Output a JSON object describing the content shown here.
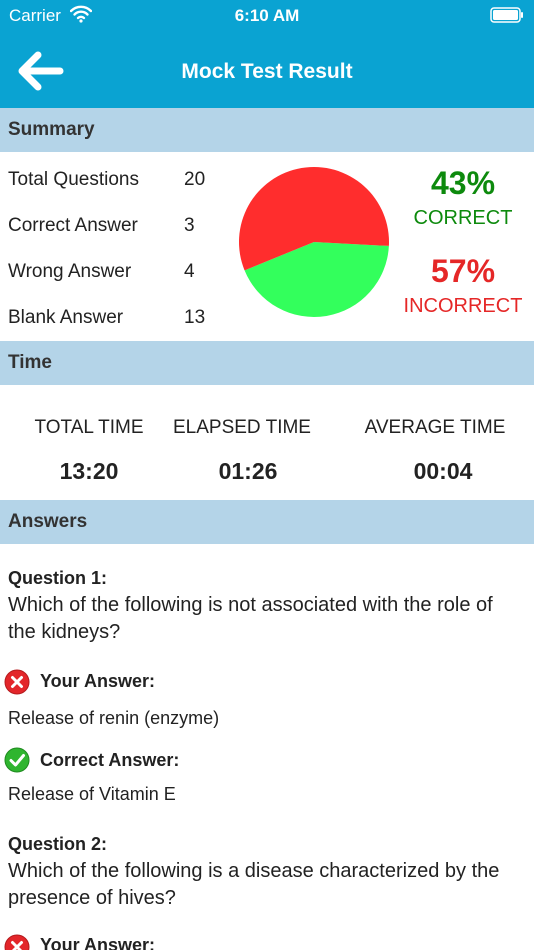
{
  "status_bar": {
    "carrier": "Carrier",
    "time": "6:10 AM"
  },
  "nav": {
    "title": "Mock Test Result",
    "back_icon": "back-arrow-icon"
  },
  "summary": {
    "header": "Summary",
    "rows": [
      {
        "label": "Total Questions",
        "value": "20"
      },
      {
        "label": "Correct Answer",
        "value": "3"
      },
      {
        "label": "Wrong Answer",
        "value": "4"
      },
      {
        "label": "Blank Answer",
        "value": "13"
      }
    ],
    "correct_pct": "43%",
    "correct_label": "CORRECT",
    "incorrect_pct": "57%",
    "incorrect_label": "INCORRECT",
    "colors": {
      "correct": "#33ff5c",
      "incorrect": "#ff2d2d",
      "correct_text": "#0d8a0d",
      "incorrect_text": "#e52727"
    }
  },
  "chart_data": {
    "type": "pie",
    "slices": [
      {
        "label": "CORRECT",
        "value": 43,
        "color": "#33ff5c"
      },
      {
        "label": "INCORRECT",
        "value": 57,
        "color": "#ff2d2d"
      }
    ]
  },
  "time": {
    "header": "Time",
    "items": [
      {
        "label": "TOTAL TIME",
        "value": "13:20"
      },
      {
        "label": "ELAPSED TIME",
        "value": "01:26"
      },
      {
        "label": "AVERAGE TIME",
        "value": "00:04"
      }
    ]
  },
  "answers": {
    "header": "Answers",
    "questions": [
      {
        "title": "Question 1:",
        "text": "Which of the following is not associated with the role of the kidneys?",
        "your_answer_label": "Your Answer:",
        "your_answer": "Release of renin (enzyme)",
        "correct_answer_label": "Correct Answer:",
        "correct_answer": "Release of Vitamin E"
      },
      {
        "title": "Question 2:",
        "text": "Which of the following is a disease characterized by the presence of hives?",
        "your_answer_label": "Your Answer:"
      }
    ]
  }
}
